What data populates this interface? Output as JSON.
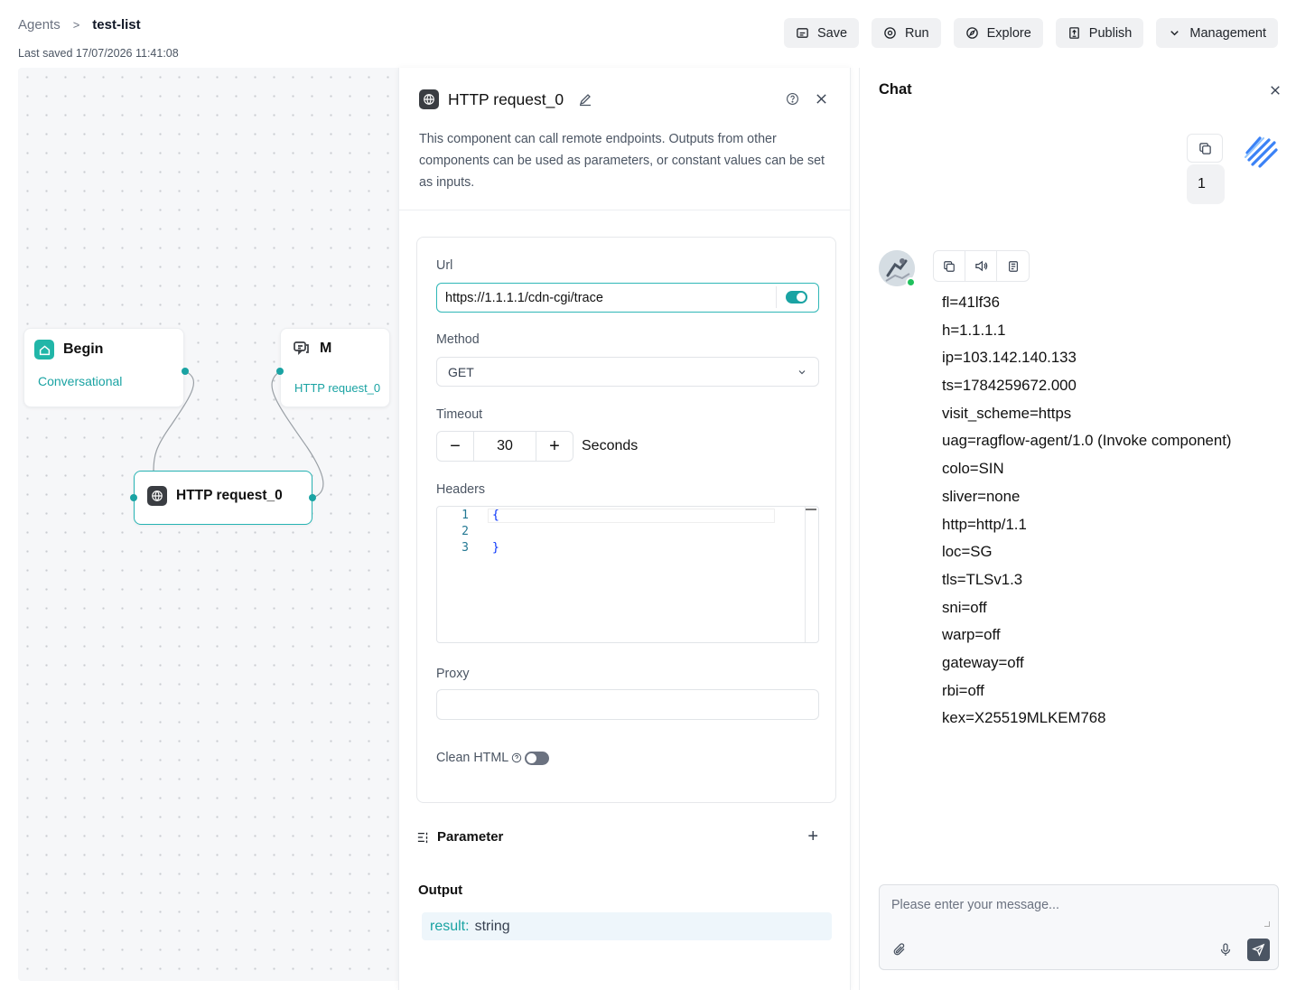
{
  "header": {
    "breadcrumb_root": "Agents",
    "breadcrumb_separator": ">",
    "breadcrumb_current": "test-list",
    "last_saved": "Last saved 17/07/2026 11:41:08"
  },
  "toolbar": {
    "save": "Save",
    "run": "Run",
    "explore": "Explore",
    "publish": "Publish",
    "management": "Management"
  },
  "canvas": {
    "nodes": {
      "begin": {
        "title": "Begin",
        "subtitle": "Conversational"
      },
      "message": {
        "title": "M",
        "subtitle": "HTTP request_0"
      },
      "http": {
        "title": "HTTP request_0"
      }
    }
  },
  "config_panel": {
    "title": "HTTP request_0",
    "description": "This component can call remote endpoints. Outputs from other components can be used as parameters, or constant values can be set as inputs.",
    "url_label": "Url",
    "url_value": "https://1.1.1.1/cdn-cgi/trace",
    "url_toggle_on": true,
    "method_label": "Method",
    "method_value": "GET",
    "timeout_label": "Timeout",
    "timeout_minus": "−",
    "timeout_value": "30",
    "timeout_plus": "+",
    "timeout_unit": "Seconds",
    "headers_label": "Headers",
    "headers_lines": [
      {
        "num": "1",
        "code": "{"
      },
      {
        "num": "2",
        "code": ""
      },
      {
        "num": "3",
        "code": "}"
      }
    ],
    "proxy_label": "Proxy",
    "proxy_value": "",
    "clean_html_label": "Clean HTML",
    "clean_html_on": false,
    "parameter_label": "Parameter",
    "parameter_add": "+",
    "output_label": "Output",
    "output_key": "result:",
    "output_type": "string"
  },
  "chat": {
    "title": "Chat",
    "user_message": "1",
    "response_lines": [
      "fl=41lf36",
      "h=1.1.1.1",
      "ip=103.142.140.133",
      "ts=1784259672.000",
      "visit_scheme=https",
      "uag=ragflow-agent/1.0 (Invoke component)",
      "colo=SIN",
      "sliver=none",
      "http=http/1.1",
      "loc=SG",
      "tls=TLSv1.3",
      "sni=off",
      "warp=off",
      "gateway=off",
      "rbi=off",
      "kex=X25519MLKEM768"
    ],
    "input_placeholder": "Please enter your message..."
  },
  "colors": {
    "accent": "#1aa3a3",
    "accent_border": "#2fb7b7",
    "online": "#20c05c",
    "canvas_bg": "#f6f7f9"
  },
  "icons": {
    "save": "save-icon",
    "run": "run-icon",
    "explore": "compass-icon",
    "publish": "publish-icon",
    "management": "chevron-down-icon",
    "edit": "pencil-icon",
    "help": "help-icon",
    "close": "close-icon",
    "copy": "copy-icon",
    "speaker": "speaker-icon",
    "document": "document-icon",
    "attach": "paperclip-icon",
    "mic": "mic-icon",
    "send": "send-icon"
  }
}
